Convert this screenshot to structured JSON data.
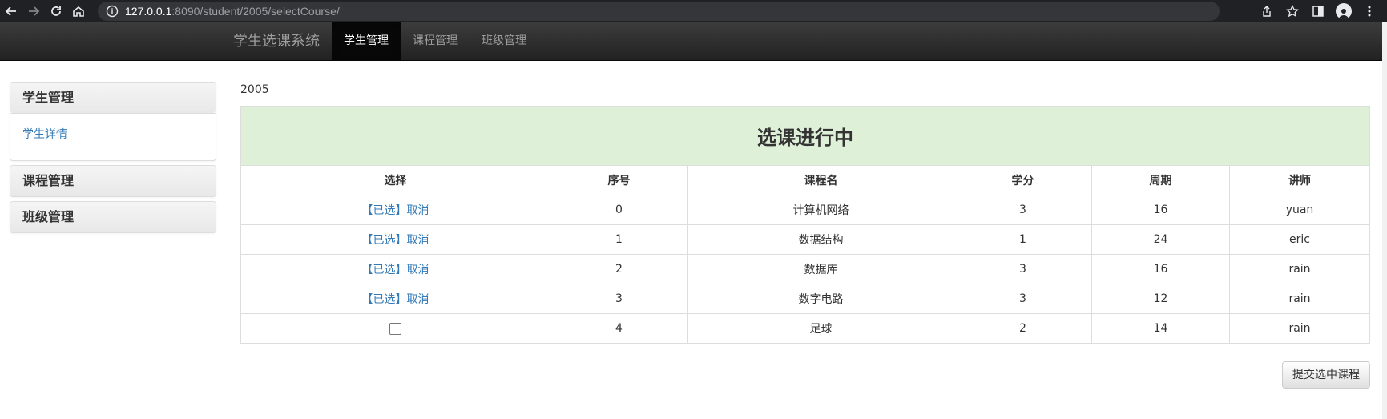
{
  "browser": {
    "url_host": "127.0.0.1",
    "url_path": ":8090/student/2005/selectCourse/"
  },
  "navbar": {
    "brand": "学生选课系统",
    "links": [
      {
        "label": "学生管理",
        "active": true
      },
      {
        "label": "课程管理",
        "active": false
      },
      {
        "label": "班级管理",
        "active": false
      }
    ]
  },
  "sidebar": {
    "panels": [
      {
        "title": "学生管理",
        "items": [
          "学生详情"
        ]
      },
      {
        "title": "课程管理",
        "items": []
      },
      {
        "title": "班级管理",
        "items": []
      }
    ]
  },
  "main": {
    "student_id": "2005",
    "table_title": "选课进行中",
    "headers": [
      "选择",
      "序号",
      "课程名",
      "学分",
      "周期",
      "讲师"
    ],
    "rows": [
      {
        "selected": true,
        "selected_label": "【已选】",
        "cancel_label": "取消",
        "index": "0",
        "name": "计算机网络",
        "credit": "3",
        "period": "16",
        "teacher": "yuan"
      },
      {
        "selected": true,
        "selected_label": "【已选】",
        "cancel_label": "取消",
        "index": "1",
        "name": "数据结构",
        "credit": "1",
        "period": "24",
        "teacher": "eric"
      },
      {
        "selected": true,
        "selected_label": "【已选】",
        "cancel_label": "取消",
        "index": "2",
        "name": "数据库",
        "credit": "3",
        "period": "16",
        "teacher": "rain"
      },
      {
        "selected": true,
        "selected_label": "【已选】",
        "cancel_label": "取消",
        "index": "3",
        "name": "数字电路",
        "credit": "3",
        "period": "12",
        "teacher": "rain"
      },
      {
        "selected": false,
        "index": "4",
        "name": "足球",
        "credit": "2",
        "period": "14",
        "teacher": "rain"
      }
    ],
    "submit_label": "提交选中课程"
  },
  "colors": {
    "link": "#337ab7",
    "title_bg": "#dff0d8",
    "navbar_dark": "#222222"
  }
}
